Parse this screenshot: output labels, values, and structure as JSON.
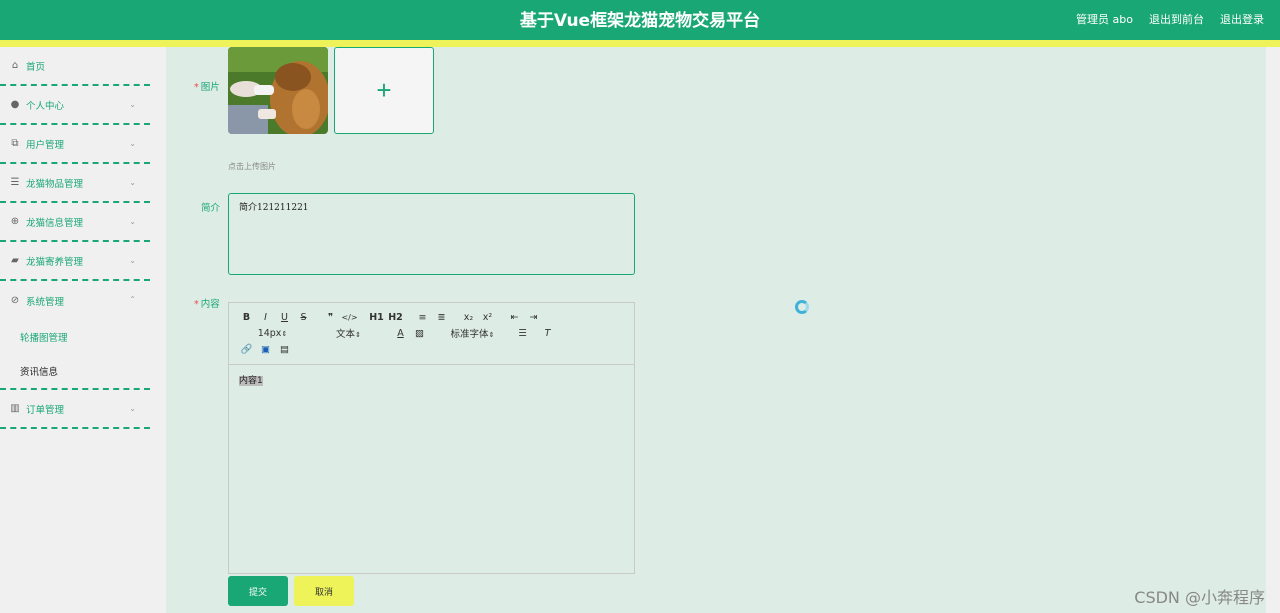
{
  "header": {
    "title": "基于Vue框架龙猫宠物交易平台",
    "links": [
      "管理员 abo",
      "退出到前台",
      "退出登录"
    ]
  },
  "sidebar": {
    "items": [
      {
        "label": "首页",
        "icon": "home-icon"
      },
      {
        "label": "个人中心",
        "icon": "user-icon"
      },
      {
        "label": "用户管理",
        "icon": "copy-icon"
      },
      {
        "label": "龙猫物品管理",
        "icon": "sliders-icon"
      },
      {
        "label": "龙猫信息管理",
        "icon": "aim-icon"
      },
      {
        "label": "龙猫寄养管理",
        "icon": "suitcase-icon"
      },
      {
        "label": "系统管理",
        "icon": "compass-icon"
      },
      {
        "label": "订单管理",
        "icon": "chart-icon"
      }
    ],
    "system_sub": [
      "轮播图管理",
      "资讯信息"
    ]
  },
  "form": {
    "image_label": "图片",
    "upload_hint": "点击上传图片",
    "intro_label": "简介",
    "intro_value": "简介121211221",
    "content_label": "内容",
    "content_value": "内容1",
    "submit_label": "提交",
    "cancel_label": "取消"
  },
  "editor": {
    "row1": [
      "B",
      "I",
      "U",
      "S",
      "❞",
      "</>",
      "H1",
      "H2",
      "≡",
      "≣",
      "x₂",
      "x²",
      "⇤",
      "⇥"
    ],
    "font_size": "14px",
    "text_style": "文本",
    "font_family": "标准字体"
  },
  "watermark": "CSDN @小奔程序"
}
